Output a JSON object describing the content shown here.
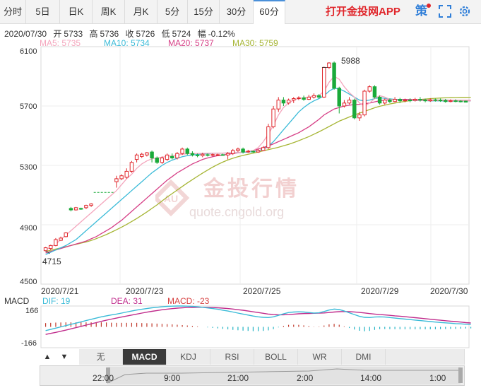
{
  "tabs": [
    {
      "label": "分时",
      "active": false
    },
    {
      "label": "5日",
      "active": false
    },
    {
      "label": "日K",
      "active": false
    },
    {
      "label": "周K",
      "active": false
    },
    {
      "label": "月K",
      "active": false
    },
    {
      "label": "5分",
      "active": false
    },
    {
      "label": "15分",
      "active": false
    },
    {
      "label": "30分",
      "active": false
    },
    {
      "label": "60分",
      "active": true
    }
  ],
  "promo_label": "打开金投网APP",
  "strategy_label": "策",
  "info": {
    "date": "2020/07/30",
    "open_label": "开",
    "open": "5733",
    "high_label": "高",
    "high": "5736",
    "close_label": "收",
    "close": "5726",
    "low_label": "低",
    "low": "5724",
    "change_label": "幅",
    "change": "-0.12%"
  },
  "ma_legend": [
    {
      "text": "MA5: 5735",
      "color": "#f4a6bd"
    },
    {
      "text": "MA10: 5734",
      "color": "#3bbbd8"
    },
    {
      "text": "MA20: 5737",
      "color": "#d63f86"
    },
    {
      "text": "MA30: 5759",
      "color": "#a6b534"
    }
  ],
  "y_axis": [
    "6100",
    "5700",
    "5300",
    "4900",
    "4500"
  ],
  "x_axis": [
    "2020/7/21",
    "2020/7/23",
    "2020/7/25",
    "2020/7/29",
    "2020/7/30"
  ],
  "annotations": {
    "max": "5988",
    "min": "4715"
  },
  "watermark": {
    "cn": "金投行情",
    "url": "quote.cngold.org"
  },
  "macd_legend": [
    {
      "text": "MACD",
      "color": "#333333"
    },
    {
      "text": "DIF: 19",
      "color": "#3bbbd8"
    },
    {
      "text": "DEA: 31",
      "color": "#c02c8c"
    },
    {
      "text": "MACD: -23",
      "color": "#d63f3f"
    }
  ],
  "macd_axis": [
    "166",
    "-166"
  ],
  "indicators": [
    {
      "label": "无",
      "active": false
    },
    {
      "label": "MACD",
      "active": true
    },
    {
      "label": "KDJ",
      "active": false
    },
    {
      "label": "RSI",
      "active": false
    },
    {
      "label": "BOLL",
      "active": false
    },
    {
      "label": "WR",
      "active": false
    },
    {
      "label": "DMI",
      "active": false
    }
  ],
  "navigator_labels": [
    "22:00",
    "9:00",
    "21:00",
    "2:00",
    "14:00",
    "1:00"
  ],
  "colors": {
    "up": "#e0262b",
    "down": "#1aaa3a",
    "accent": "#4a90d9"
  },
  "chart_data": {
    "type": "candlestick",
    "ylim": [
      4500,
      6100
    ],
    "macd_ylim": [
      -166,
      166
    ],
    "candles": [
      [
        4725,
        4745,
        4720,
        4750
      ],
      [
        4740,
        4760,
        4730,
        4765
      ],
      [
        4760,
        4800,
        4755,
        4810
      ],
      [
        4795,
        4810,
        4790,
        4820
      ],
      [
        4820,
        4845,
        4815,
        4850
      ],
      [
        5010,
        5000,
        4990,
        5020
      ],
      [
        5000,
        5015,
        4995,
        5020
      ],
      [
        5010,
        5005,
        5000,
        5015
      ],
      [
        5015,
        5030,
        5005,
        5035
      ],
      [
        5030,
        5040,
        5020,
        5045
      ],
      [
        5118,
        5118,
        5115,
        5120
      ],
      [
        5118,
        5118,
        5115,
        5120
      ],
      [
        5118,
        5118,
        5115,
        5120
      ],
      [
        5118,
        5118,
        5115,
        5120
      ],
      [
        5190,
        5210,
        5150,
        5230
      ],
      [
        5210,
        5230,
        5200,
        5240
      ],
      [
        5220,
        5260,
        5210,
        5280
      ],
      [
        5260,
        5320,
        5250,
        5330
      ],
      [
        5340,
        5370,
        5320,
        5380
      ],
      [
        5360,
        5375,
        5350,
        5385
      ],
      [
        5370,
        5385,
        5360,
        5390
      ],
      [
        5390,
        5350,
        5320,
        5400
      ],
      [
        5350,
        5320,
        5310,
        5360
      ],
      [
        5320,
        5350,
        5310,
        5360
      ],
      [
        5340,
        5370,
        5330,
        5380
      ],
      [
        5360,
        5350,
        5340,
        5380
      ],
      [
        5350,
        5380,
        5340,
        5390
      ],
      [
        5380,
        5410,
        5370,
        5420
      ],
      [
        5410,
        5380,
        5370,
        5420
      ],
      [
        5380,
        5370,
        5360,
        5395
      ],
      [
        5370,
        5365,
        5355,
        5380
      ],
      [
        5365,
        5375,
        5355,
        5385
      ],
      [
        5372,
        5368,
        5360,
        5380
      ],
      [
        5368,
        5373,
        5360,
        5380
      ],
      [
        5370,
        5372,
        5365,
        5378
      ],
      [
        5372,
        5370,
        5365,
        5378
      ],
      [
        5370,
        5380,
        5340,
        5390
      ],
      [
        5380,
        5400,
        5370,
        5410
      ],
      [
        5400,
        5410,
        5390,
        5420
      ],
      [
        5410,
        5390,
        5380,
        5420
      ],
      [
        5390,
        5395,
        5385,
        5405
      ],
      [
        5395,
        5390,
        5385,
        5400
      ],
      [
        5390,
        5400,
        5385,
        5410
      ],
      [
        5400,
        5420,
        5395,
        5430
      ],
      [
        5420,
        5560,
        5410,
        5580
      ],
      [
        5560,
        5680,
        5550,
        5700
      ],
      [
        5680,
        5740,
        5660,
        5760
      ],
      [
        5740,
        5720,
        5700,
        5760
      ],
      [
        5720,
        5740,
        5710,
        5750
      ],
      [
        5740,
        5750,
        5720,
        5760
      ],
      [
        5750,
        5755,
        5740,
        5765
      ],
      [
        5755,
        5745,
        5735,
        5770
      ],
      [
        5745,
        5760,
        5740,
        5775
      ],
      [
        5760,
        5770,
        5750,
        5785
      ],
      [
        5770,
        5760,
        5750,
        5780
      ],
      [
        5760,
        5960,
        5755,
        5965
      ],
      [
        5960,
        5990,
        5950,
        5995
      ],
      [
        5990,
        5820,
        5810,
        6000
      ],
      [
        5820,
        5700,
        5650,
        5830
      ],
      [
        5700,
        5720,
        5690,
        5740
      ],
      [
        5720,
        5740,
        5710,
        5760
      ],
      [
        5740,
        5620,
        5610,
        5750
      ],
      [
        5620,
        5640,
        5600,
        5660
      ],
      [
        5640,
        5800,
        5630,
        5810
      ],
      [
        5800,
        5830,
        5790,
        5840
      ],
      [
        5830,
        5760,
        5750,
        5840
      ],
      [
        5760,
        5720,
        5710,
        5770
      ],
      [
        5720,
        5740,
        5710,
        5750
      ],
      [
        5740,
        5730,
        5720,
        5750
      ],
      [
        5730,
        5745,
        5725,
        5760
      ],
      [
        5745,
        5735,
        5720,
        5755
      ],
      [
        5735,
        5740,
        5725,
        5750
      ],
      [
        5740,
        5738,
        5725,
        5752
      ],
      [
        5738,
        5745,
        5730,
        5755
      ],
      [
        5745,
        5740,
        5730,
        5760
      ],
      [
        5740,
        5735,
        5725,
        5750
      ],
      [
        5735,
        5742,
        5728,
        5752
      ],
      [
        5742,
        5740,
        5730,
        5750
      ],
      [
        5740,
        5738,
        5728,
        5750
      ],
      [
        5738,
        5730,
        5722,
        5748
      ],
      [
        5730,
        5735,
        5725,
        5745
      ],
      [
        5735,
        5733,
        5725,
        5745
      ],
      [
        5733,
        5730,
        5724,
        5740
      ],
      [
        5733,
        5726,
        5724,
        5736
      ]
    ],
    "ma5": [
      4730,
      4750,
      4770,
      4800,
      4830,
      4860,
      4890,
      4920,
      4950,
      4980,
      5010,
      5040,
      5070,
      5100,
      5130,
      5170,
      5210,
      5240,
      5280,
      5310,
      5330,
      5345,
      5350,
      5355,
      5360,
      5365,
      5370,
      5375,
      5378,
      5380,
      5380,
      5381,
      5382,
      5382,
      5382,
      5383,
      5384,
      5385,
      5386,
      5390,
      5395,
      5400,
      5420,
      5460,
      5510,
      5570,
      5640,
      5690,
      5720,
      5740,
      5750,
      5755,
      5760,
      5765,
      5770,
      5800,
      5860,
      5900,
      5880,
      5830,
      5790,
      5760,
      5720,
      5700,
      5720,
      5750,
      5770,
      5760,
      5745,
      5740,
      5740,
      5738,
      5738,
      5738,
      5737,
      5737,
      5737,
      5736,
      5736,
      5736,
      5736,
      5736,
      5735,
      5735,
      5735
    ],
    "ma10": [
      4700,
      4715,
      4730,
      4745,
      4760,
      4780,
      4800,
      4830,
      4860,
      4890,
      4920,
      4950,
      4980,
      5010,
      5040,
      5070,
      5100,
      5130,
      5160,
      5190,
      5220,
      5250,
      5275,
      5300,
      5320,
      5335,
      5348,
      5358,
      5365,
      5370,
      5374,
      5377,
      5379,
      5381,
      5382,
      5383,
      5384,
      5385,
      5386,
      5388,
      5390,
      5393,
      5398,
      5410,
      5430,
      5460,
      5500,
      5540,
      5580,
      5620,
      5660,
      5690,
      5715,
      5735,
      5750,
      5770,
      5800,
      5820,
      5815,
      5800,
      5780,
      5760,
      5740,
      5735,
      5740,
      5750,
      5755,
      5752,
      5748,
      5745,
      5742,
      5740,
      5738,
      5737,
      5736,
      5736,
      5735,
      5735,
      5735,
      5734,
      5734,
      5734,
      5734,
      5734,
      5734
    ],
    "ma20": [
      4710,
      4720,
      4730,
      4740,
      4750,
      4760,
      4770,
      4780,
      4790,
      4805,
      4820,
      4840,
      4860,
      4880,
      4905,
      4930,
      4960,
      4990,
      5020,
      5050,
      5080,
      5110,
      5140,
      5170,
      5200,
      5225,
      5250,
      5270,
      5290,
      5310,
      5325,
      5340,
      5350,
      5358,
      5365,
      5370,
      5375,
      5380,
      5385,
      5390,
      5395,
      5400,
      5410,
      5420,
      5432,
      5445,
      5460,
      5475,
      5490,
      5505,
      5520,
      5540,
      5560,
      5585,
      5610,
      5640,
      5660,
      5680,
      5690,
      5700,
      5705,
      5710,
      5712,
      5715,
      5720,
      5728,
      5735,
      5740,
      5742,
      5744,
      5745,
      5745,
      5744,
      5743,
      5742,
      5741,
      5740,
      5740,
      5739,
      5739,
      5738,
      5738,
      5737,
      5737,
      5737
    ],
    "ma30": [
      4720,
      4728,
      4736,
      4744,
      4752,
      4760,
      4768,
      4776,
      4784,
      4794,
      4806,
      4820,
      4834,
      4850,
      4866,
      4884,
      4902,
      4922,
      4942,
      4964,
      4986,
      5010,
      5034,
      5060,
      5086,
      5110,
      5134,
      5158,
      5182,
      5204,
      5226,
      5248,
      5268,
      5288,
      5306,
      5322,
      5336,
      5348,
      5358,
      5367,
      5375,
      5382,
      5390,
      5398,
      5406,
      5414,
      5422,
      5432,
      5442,
      5454,
      5466,
      5480,
      5494,
      5510,
      5526,
      5544,
      5562,
      5580,
      5598,
      5612,
      5626,
      5640,
      5652,
      5664,
      5676,
      5688,
      5698,
      5706,
      5714,
      5720,
      5726,
      5731,
      5736,
      5740,
      5744,
      5747,
      5750,
      5752,
      5754,
      5755,
      5756,
      5757,
      5758,
      5758,
      5759
    ],
    "dif": [
      -30,
      -20,
      -10,
      0,
      10,
      20,
      30,
      40,
      50,
      60,
      70,
      80,
      88,
      95,
      102,
      110,
      118,
      126,
      134,
      140,
      146,
      152,
      156,
      160,
      163,
      165,
      166,
      166,
      165,
      163,
      160,
      156,
      151,
      146,
      140,
      133,
      126,
      118,
      110,
      102,
      94,
      86,
      80,
      76,
      74,
      80,
      92,
      104,
      114,
      118,
      120,
      118,
      114,
      110,
      112,
      122,
      134,
      142,
      138,
      126,
      112,
      98,
      84,
      76,
      74,
      78,
      80,
      78,
      74,
      70,
      66,
      62,
      58,
      54,
      50,
      46,
      42,
      38,
      35,
      32,
      29,
      26,
      24,
      21,
      19
    ],
    "dea": [
      -60,
      -52,
      -44,
      -35,
      -26,
      -16,
      -6,
      4,
      14,
      24,
      34,
      44,
      53,
      62,
      70,
      78,
      86,
      94,
      102,
      110,
      117,
      124,
      130,
      136,
      141,
      145,
      149,
      152,
      154,
      155,
      156,
      156,
      155,
      154,
      152,
      149,
      146,
      142,
      137,
      132,
      126,
      120,
      114,
      108,
      102,
      98,
      96,
      96,
      98,
      101,
      104,
      106,
      107,
      108,
      109,
      111,
      114,
      118,
      121,
      122,
      121,
      119,
      115,
      111,
      106,
      102,
      98,
      95,
      92,
      88,
      85,
      81,
      77,
      73,
      69,
      65,
      61,
      57,
      53,
      49,
      45,
      42,
      38,
      34,
      31
    ],
    "macd": [
      30,
      32,
      34,
      35,
      36,
      36,
      36,
      36,
      36,
      36,
      36,
      36,
      35,
      33,
      32,
      32,
      32,
      32,
      32,
      30,
      29,
      28,
      26,
      24,
      22,
      20,
      17,
      14,
      11,
      8,
      4,
      0,
      -4,
      -8,
      -12,
      -16,
      -20,
      -24,
      -27,
      -30,
      -32,
      -34,
      -34,
      -32,
      -28,
      -18,
      -4,
      8,
      16,
      17,
      16,
      12,
      7,
      2,
      3,
      11,
      20,
      24,
      17,
      4,
      -9,
      -21,
      -31,
      -35,
      -32,
      -24,
      -18,
      -17,
      -18,
      -18,
      -19,
      -19,
      -19,
      -19,
      -19,
      -19,
      -19,
      -19,
      -18,
      -17,
      -16,
      -16,
      -14,
      -13,
      -12
    ]
  }
}
